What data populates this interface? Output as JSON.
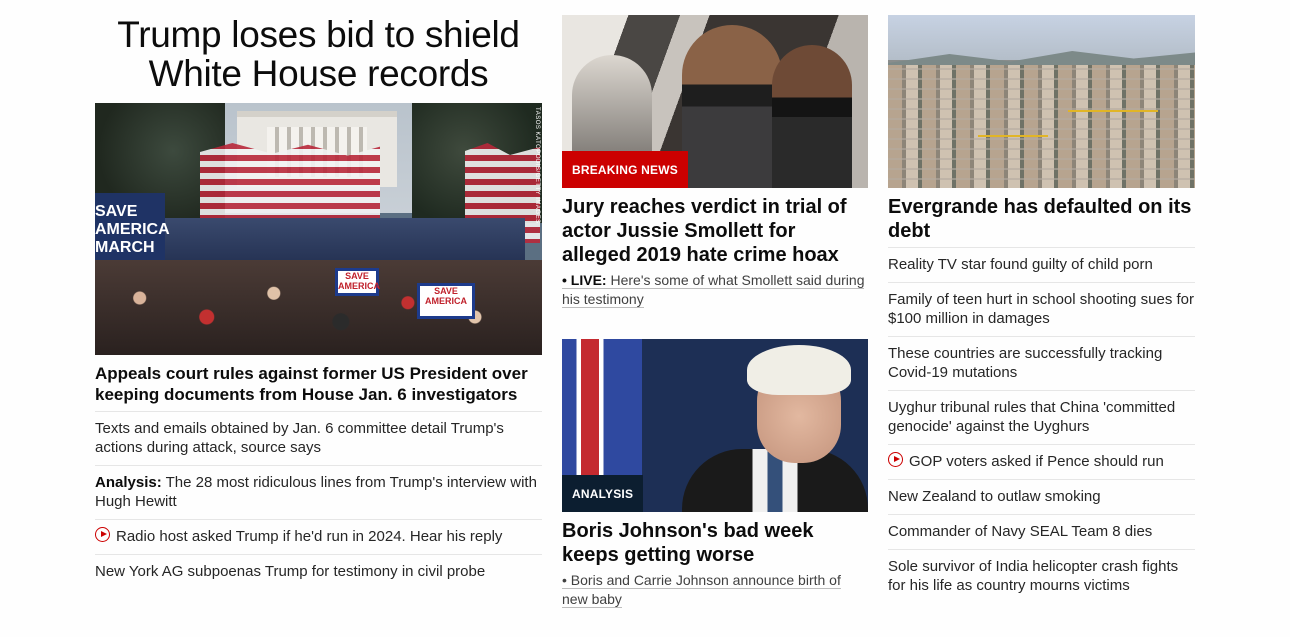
{
  "col1": {
    "headline": "Trump loses bid to shield White House records",
    "image": {
      "banner_text": "SAVE AMERICA MARCH",
      "sign_text": "SAVE AMERICA",
      "credit": "TASOS KATOPODIS/GETTY IMAGES"
    },
    "lead_title": "Appeals court rules against former US President over keeping documents from House Jan. 6 investigators",
    "items": [
      {
        "prefix": "",
        "text": "Texts and emails obtained by Jan. 6 committee detail Trump's actions during attack, source says",
        "icon": ""
      },
      {
        "prefix": "Analysis:",
        "text": " The 28 most ridiculous lines from Trump's interview with Hugh Hewitt",
        "icon": ""
      },
      {
        "prefix": "",
        "text": "Radio host asked Trump if he'd run in 2024. Hear his reply",
        "icon": "play-circle-icon"
      },
      {
        "prefix": "",
        "text": "New York AG subpoenas Trump for testimony in civil probe",
        "icon": ""
      }
    ]
  },
  "col2": {
    "card1": {
      "label": "BREAKING NEWS",
      "title": "Jury reaches verdict in trial of actor Jussie Smollett for alleged 2019 hate crime hoax",
      "sub_prefix": "• LIVE:",
      "sub_text": " Here's some of what Smollett said during his testimony"
    },
    "card2": {
      "label": "ANALYSIS",
      "title": "Boris Johnson's bad week keeps getting worse",
      "sub_text": "• Boris and Carrie Johnson announce birth of new baby"
    }
  },
  "col3": {
    "title": "Evergrande has defaulted on its debt",
    "items": [
      {
        "text": "Reality TV star found guilty of child porn",
        "icon": ""
      },
      {
        "text": "Family of teen hurt in school shooting sues for $100 million in damages",
        "icon": ""
      },
      {
        "text": "These countries are successfully tracking Covid-19 mutations",
        "icon": ""
      },
      {
        "text": "Uyghur tribunal rules that China 'committed genocide' against the Uyghurs",
        "icon": ""
      },
      {
        "text": "GOP voters asked if Pence should run",
        "icon": "play-circle-icon"
      },
      {
        "text": "New Zealand to outlaw smoking",
        "icon": ""
      },
      {
        "text": "Commander of Navy SEAL Team 8 dies",
        "icon": ""
      },
      {
        "text": "Sole survivor of India helicopter crash fights for his life as country mourns victims",
        "icon": ""
      }
    ]
  },
  "colors": {
    "label_red": "#cc0000",
    "label_dark": "#0c1e30",
    "play_icon": "#cc0000"
  }
}
